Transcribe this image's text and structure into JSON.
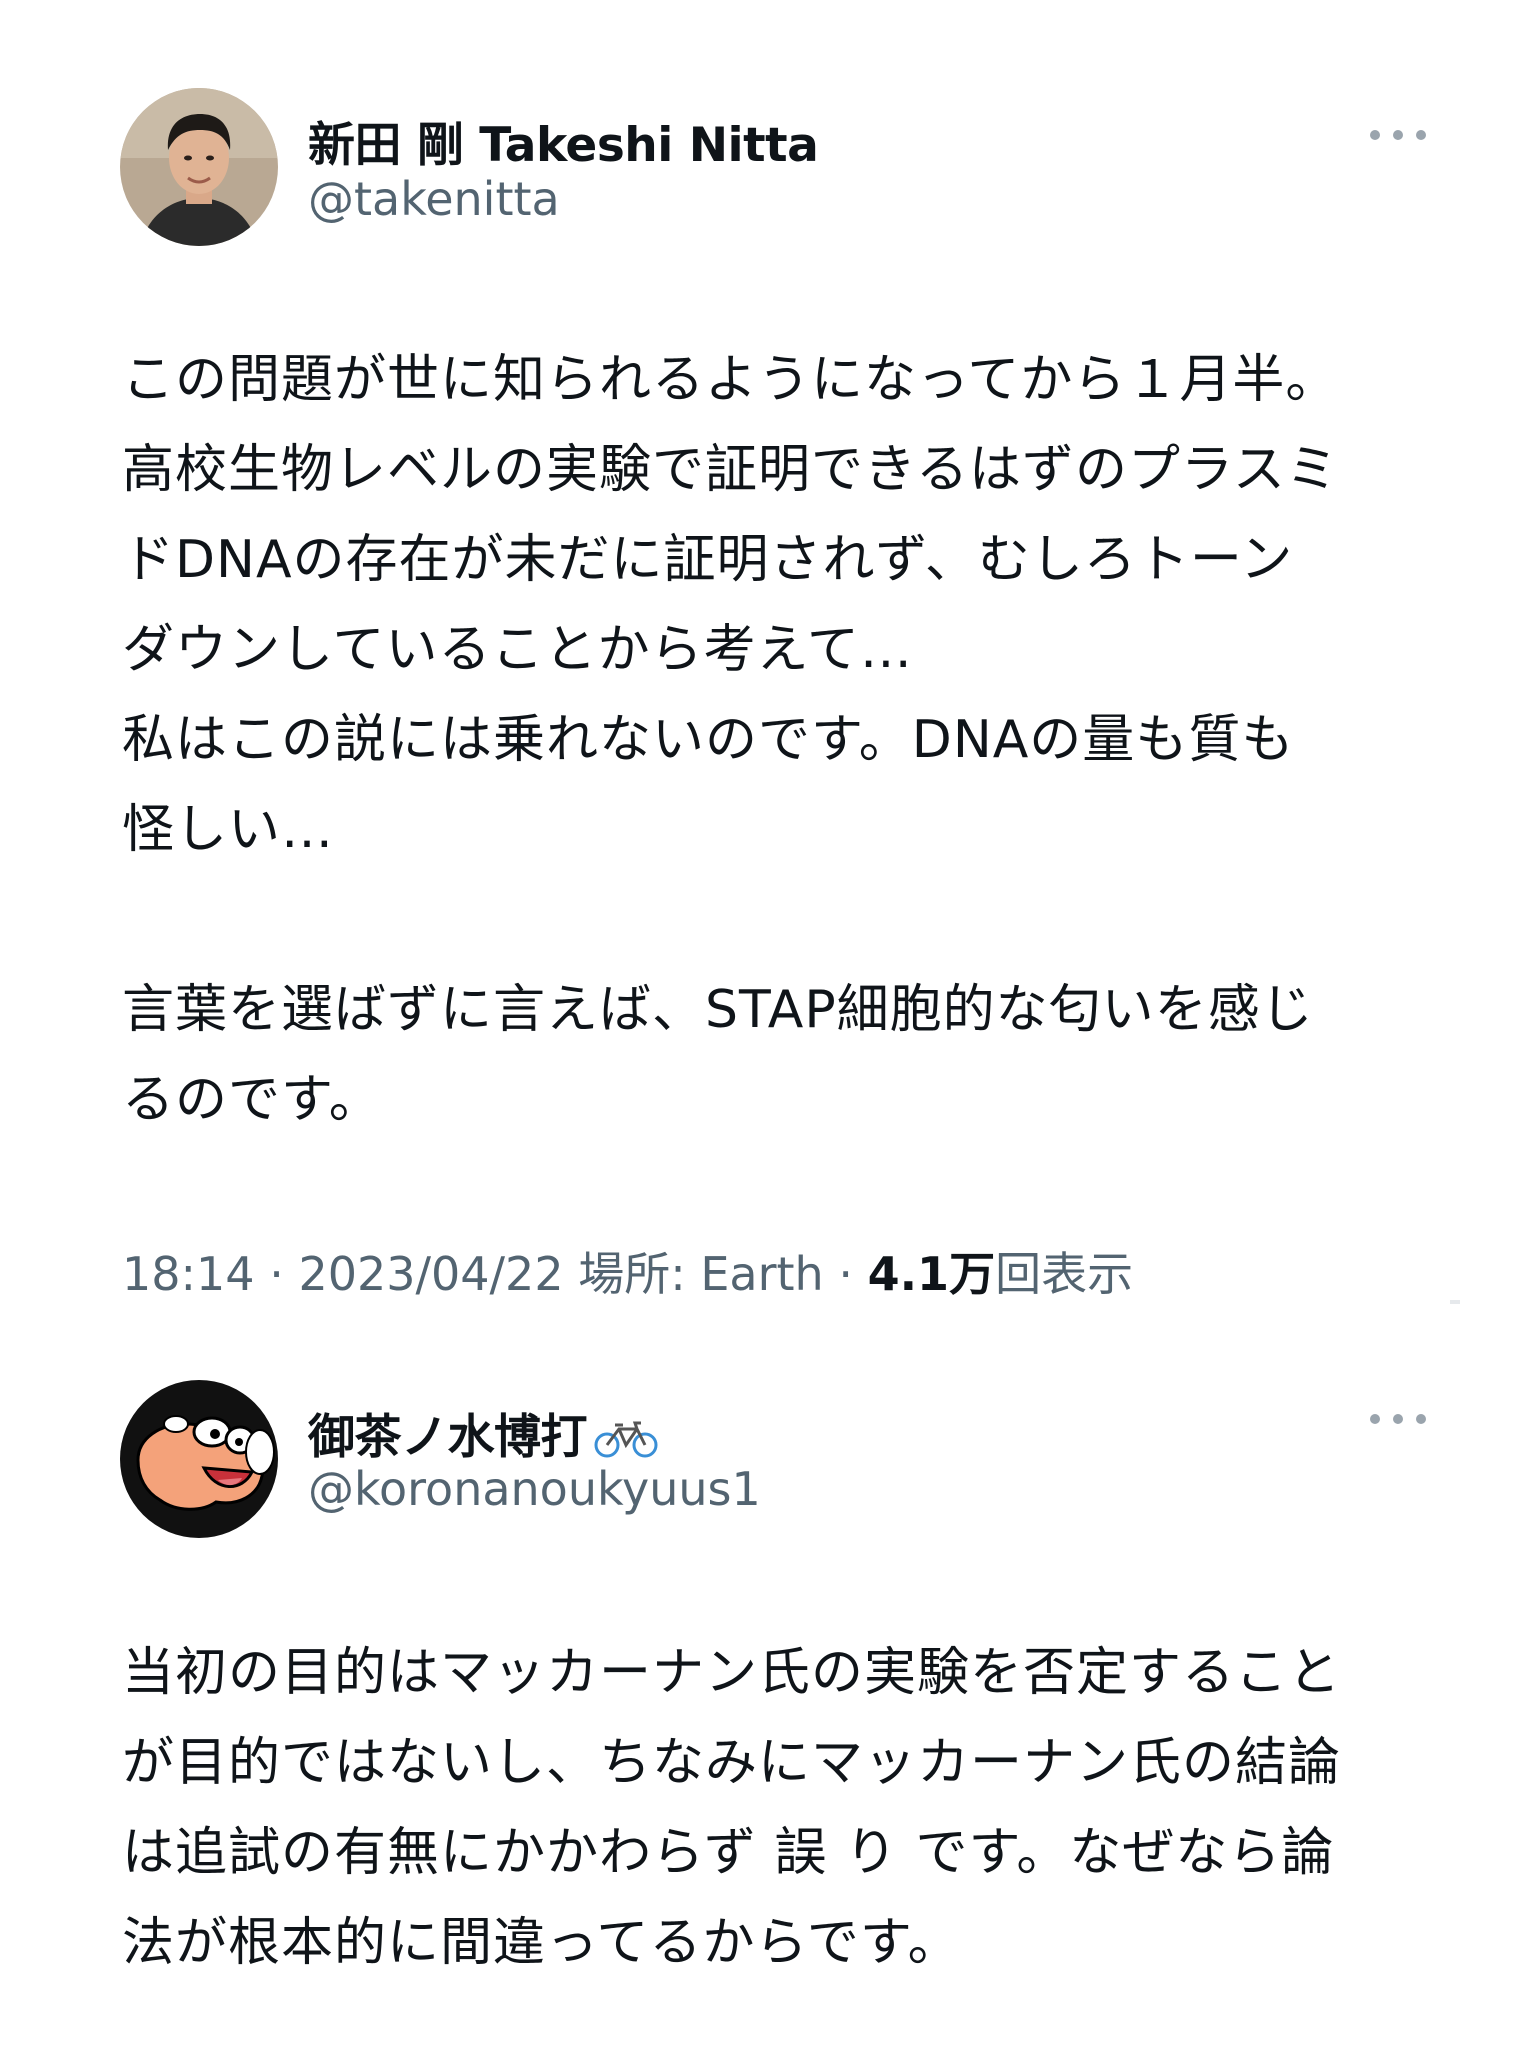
{
  "tweet1": {
    "display_name": "新田 剛 Takeshi Nitta",
    "handle": "@takenitta",
    "avatar_icon": "user-photo-avatar",
    "more_icon": "more-horizontal-icon",
    "lines": [
      "この問題が世に知られるようになってから１月半。",
      "高校生物レベルの実験で証明できるはずのプラスミ",
      "ドDNAの存在が未だに証明されず、むしろトーン",
      "ダウンしていることから考えて…",
      "私はこの説には乗れないのです。DNAの量も質も",
      "怪しい…"
    ],
    "line7_before": "言葉を選ばずに言えば、",
    "line7_underlined": "STAP細胞的な匂い",
    "line7_after": "を感じ",
    "line8": "るのです。",
    "time": "18:14",
    "date": "2023/04/22",
    "location": "場所: Earth",
    "view_count": "4.1万",
    "view_label": "回表示",
    "separator": "·"
  },
  "tweet2": {
    "display_name": "御茶ノ水博打",
    "name_emoji_icon": "bicycle-icon",
    "handle": "@koronanoukyuus1",
    "avatar_icon": "cartoon-face-avatar",
    "more_icon": "more-horizontal-icon",
    "lines": [
      "当初の目的はマッカーナン氏の実験を否定すること",
      "が目的ではないし、ちなみにマッカーナン氏の結論",
      "は追試の有無にかかわらず 誤 り です。なぜなら論"
    ],
    "line4_before": "法が",
    "line4_underlined": "根本的に間違ってる",
    "line4_after": "からです。"
  },
  "colors": {
    "text": "#0f1419",
    "secondary": "#536471",
    "underline": "#e8192c"
  }
}
